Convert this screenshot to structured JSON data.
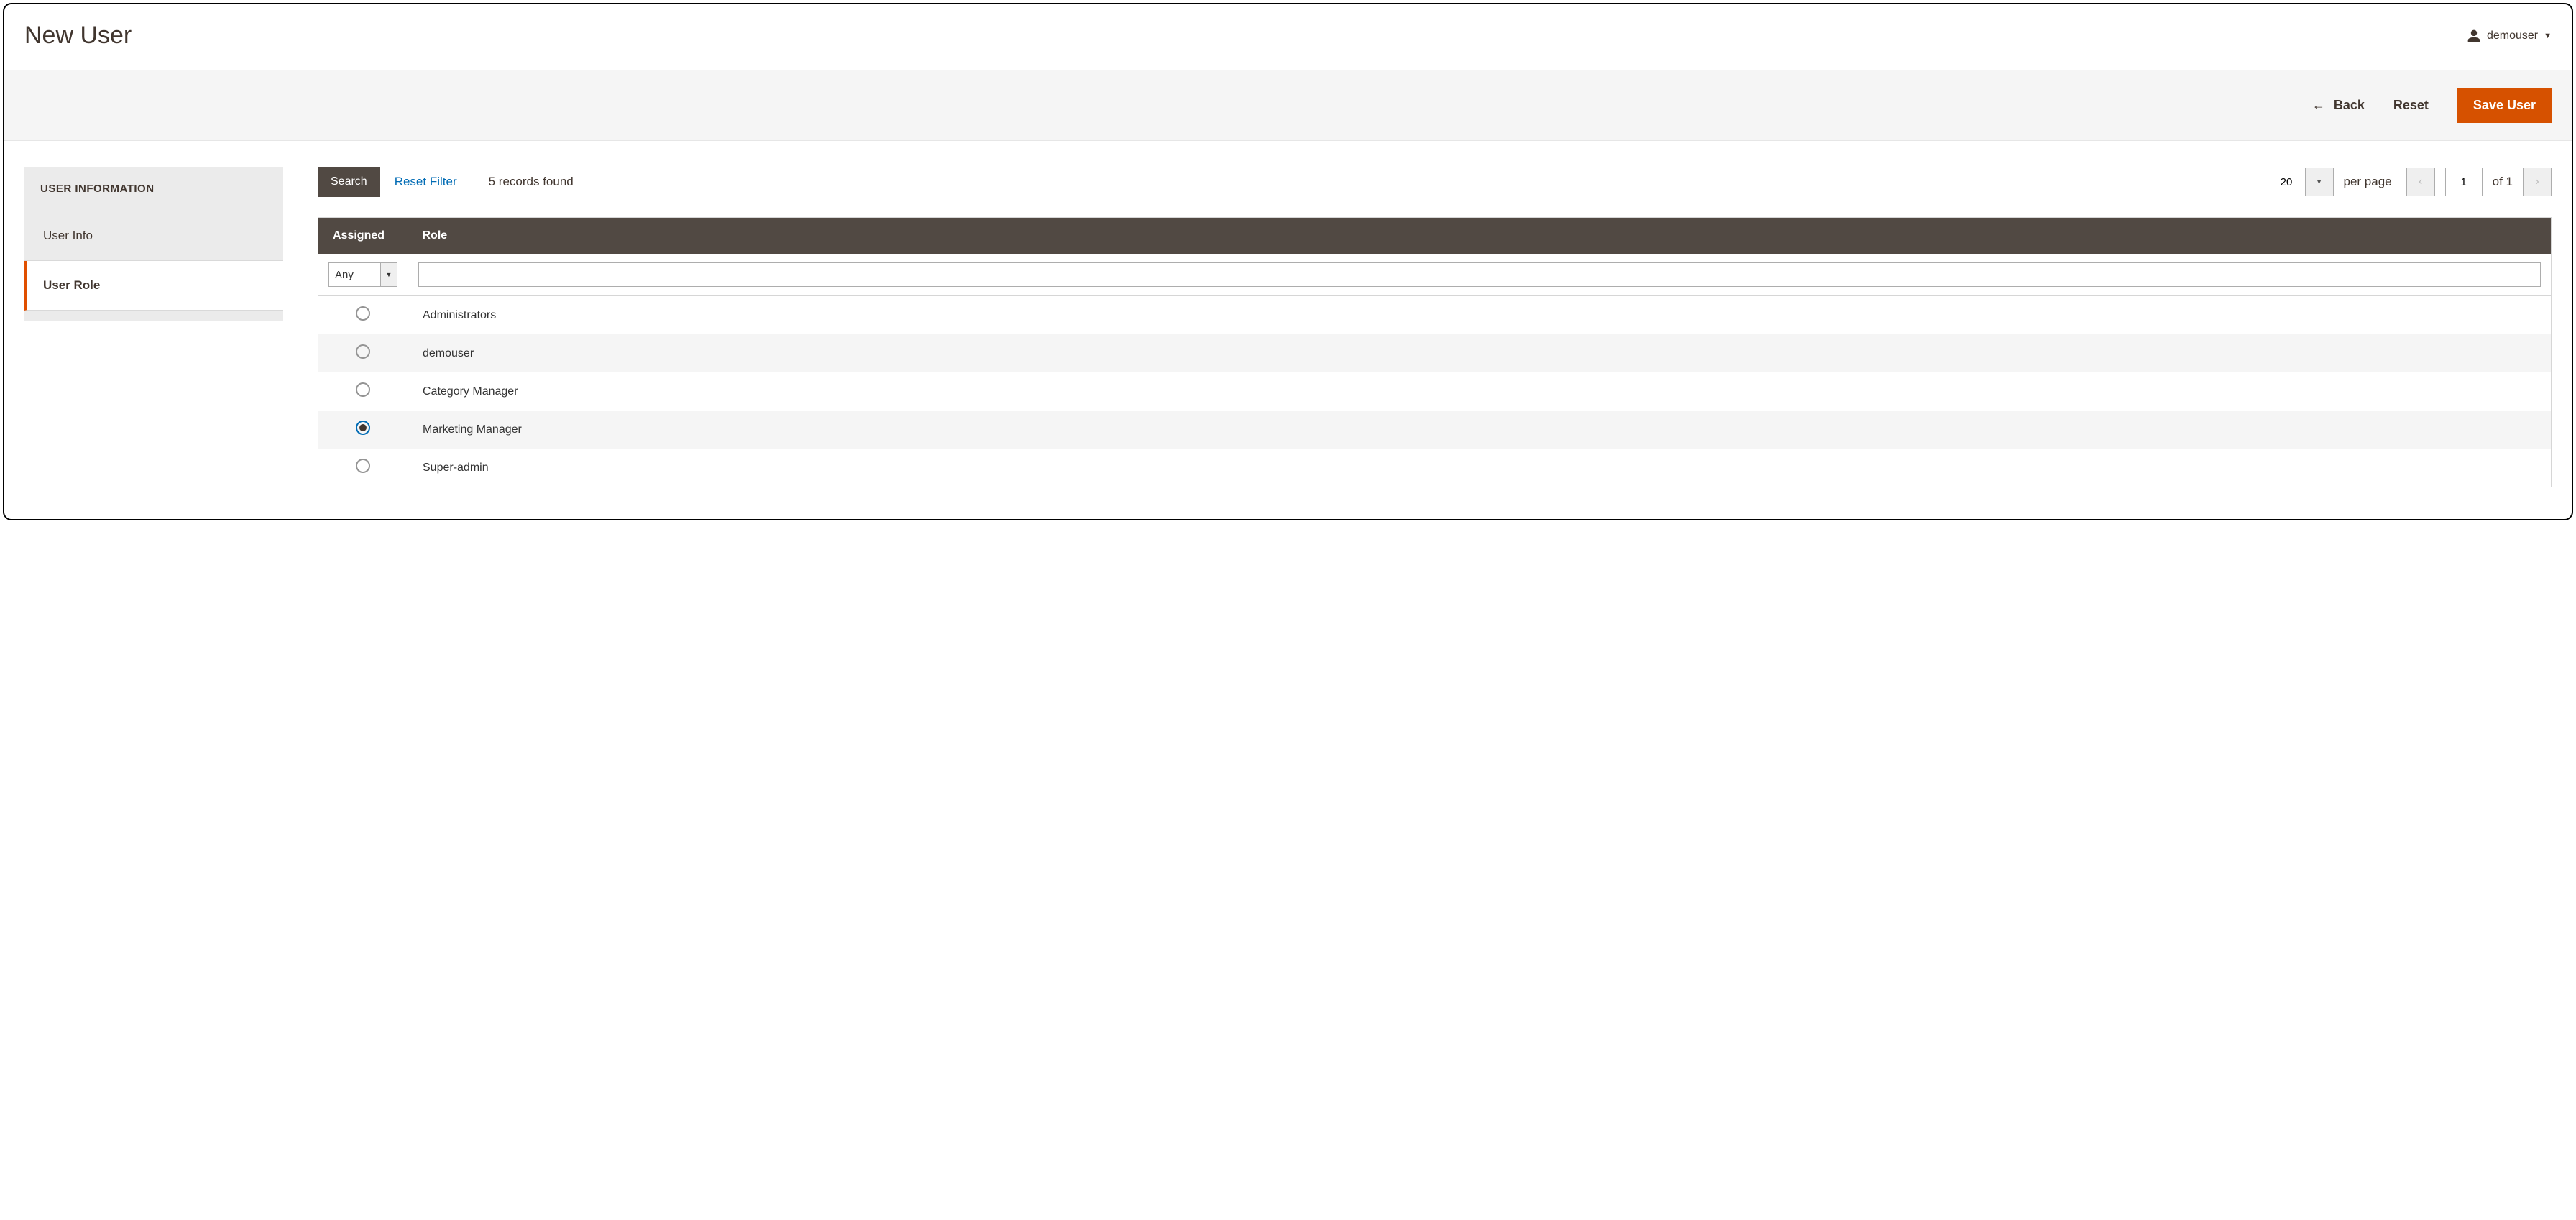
{
  "page": {
    "title": "New User"
  },
  "account": {
    "username": "demouser"
  },
  "actions": {
    "back": "Back",
    "reset": "Reset",
    "save": "Save User"
  },
  "sidebar": {
    "heading": "USER INFORMATION",
    "items": [
      {
        "label": "User Info",
        "active": false
      },
      {
        "label": "User Role",
        "active": true
      }
    ]
  },
  "toolbar": {
    "search": "Search",
    "reset_filter": "Reset Filter",
    "records_found": "5 records found",
    "per_page_value": "20",
    "per_page_label": "per page",
    "page_value": "1",
    "page_total_label": "of 1"
  },
  "grid": {
    "columns": {
      "assigned": "Assigned",
      "role": "Role"
    },
    "filter": {
      "assigned_selected": "Any",
      "role_value": ""
    },
    "rows": [
      {
        "role": "Administrators",
        "selected": false
      },
      {
        "role": "demouser",
        "selected": false
      },
      {
        "role": "Category Manager",
        "selected": false
      },
      {
        "role": "Marketing Manager",
        "selected": true
      },
      {
        "role": "Super-admin",
        "selected": false
      }
    ]
  }
}
